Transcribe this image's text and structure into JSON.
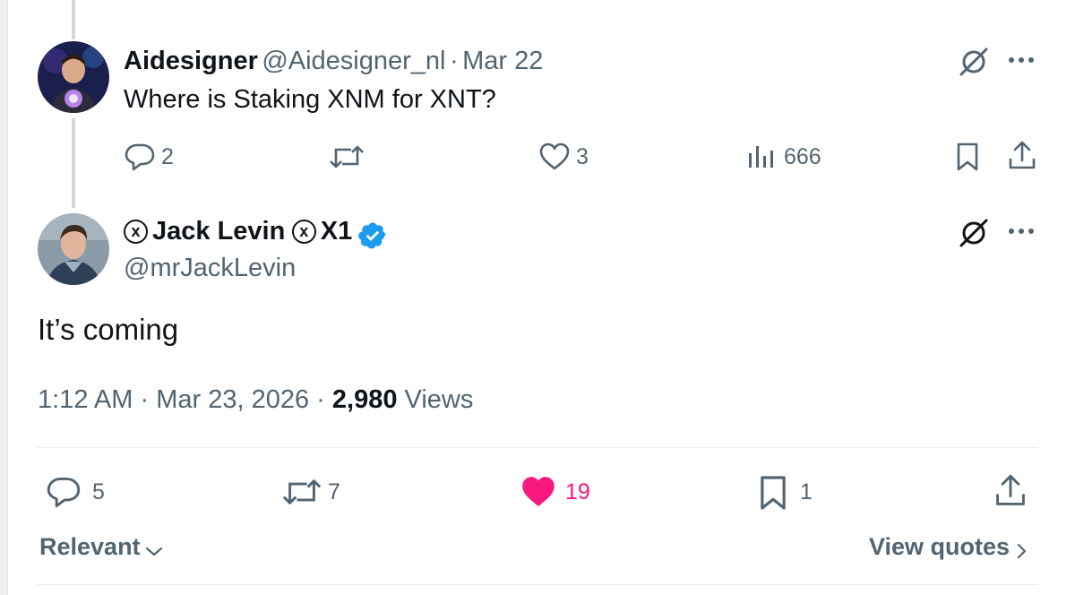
{
  "parent_tweet": {
    "display_name": "Aidesigner",
    "handle": "@Aidesigner_nl",
    "separator": "·",
    "date": "Mar 22",
    "text": "Where is Staking XNM for XNT?",
    "actions": {
      "replies": "2",
      "retweets": "",
      "likes": "3",
      "views": "666"
    }
  },
  "main_tweet": {
    "display_name": "Jack Levin",
    "name_suffix": "X1",
    "name_badge_glyph": "x",
    "handle": "@mrJackLevin",
    "text": "It’s coming",
    "meta": {
      "time": "1:12 AM",
      "separator": "·",
      "date": "Mar 23, 2026",
      "views_count": "2,980",
      "views_label": "Views"
    },
    "actions": {
      "replies": "5",
      "retweets": "7",
      "likes": "19",
      "bookmarks": "1"
    },
    "liked": true
  },
  "footer": {
    "sort_label": "Relevant",
    "view_quotes_label": "View quotes"
  },
  "colors": {
    "accent_verified": "#1d9bf0",
    "like_active": "#f91880",
    "muted": "#536471"
  },
  "icons": [
    "grok-icon",
    "more-icon",
    "reply-icon",
    "retweet-icon",
    "like-icon",
    "analytics-icon",
    "bookmark-icon",
    "share-icon",
    "verified-badge-icon",
    "chevron-down-icon",
    "chevron-right-icon"
  ]
}
